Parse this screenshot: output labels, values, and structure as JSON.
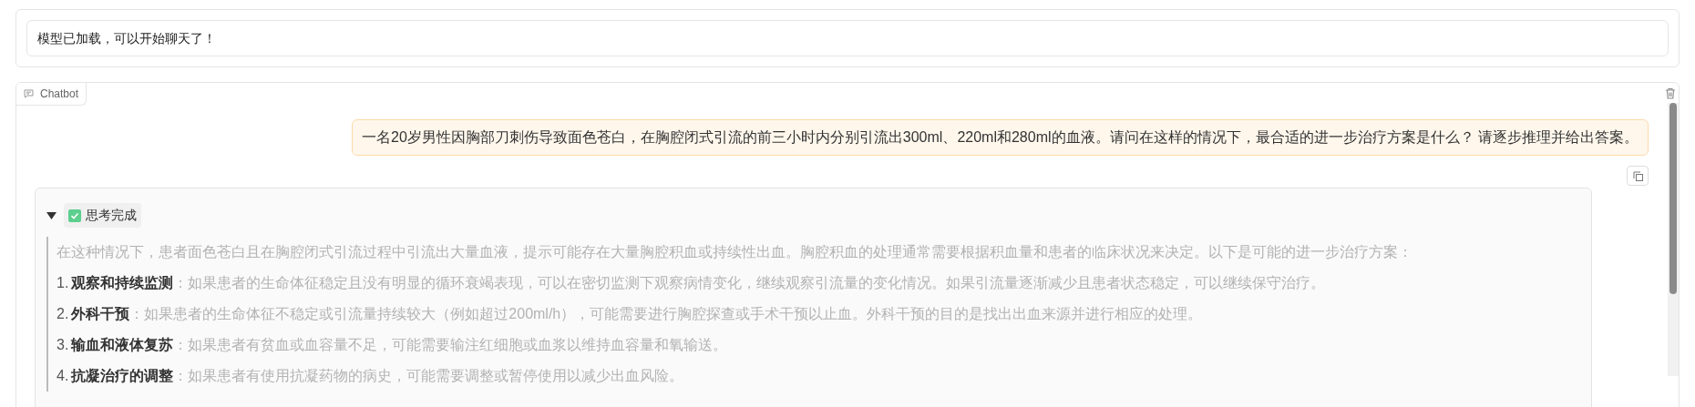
{
  "status_box": {
    "text": "模型已加载，可以开始聊天了！"
  },
  "chatbot": {
    "label": "Chatbot",
    "user_message": {
      "text": "一名20岁男性因胸部刀刺伤导致面色苍白，在胸腔闭式引流的前三小时内分别引流出300ml、220ml和280ml的血液。请问在这样的情况下，最合适的进一步治疗方案是什么？ 请逐步推理并给出答案。"
    },
    "thinking": {
      "expanded": true,
      "status": "思考完成",
      "intro": "在这种情况下，患者面色苍白且在胸腔闭式引流过程中引流出大量血液，提示可能存在大量胸腔积血或持续性出血。胸腔积血的处理通常需要根据积血量和患者的临床状况来决定。以下是可能的进一步治疗方案：",
      "items": [
        {
          "number": "1.",
          "text": "**观察和持续监测**：如果患者的生命体征稳定且没有明显的循环衰竭表现，可以在密切监测下观察病情变化，继续观察引流量的变化情况。如果引流量逐渐减少且患者状态稳定，可以继续保守治疗。"
        },
        {
          "number": "2.",
          "text": "**外科干预**：如果患者的生命体征不稳定或引流量持续较大（例如超过200ml/h），可能需要进行胸腔探查或手术干预以止血。外科干预的目的是找出出血来源并进行相应的处理。"
        },
        {
          "number": "3.",
          "text": "**输血和液体复苏**：如果患者有贫血或血容量不足，可能需要输注红细胞或血浆以维持血容量和氧输送。"
        },
        {
          "number": "4.",
          "text": "**抗凝治疗的调整**：如果患者有使用抗凝药物的病史，可能需要调整或暂停使用以减少出血风险。"
        }
      ]
    }
  }
}
